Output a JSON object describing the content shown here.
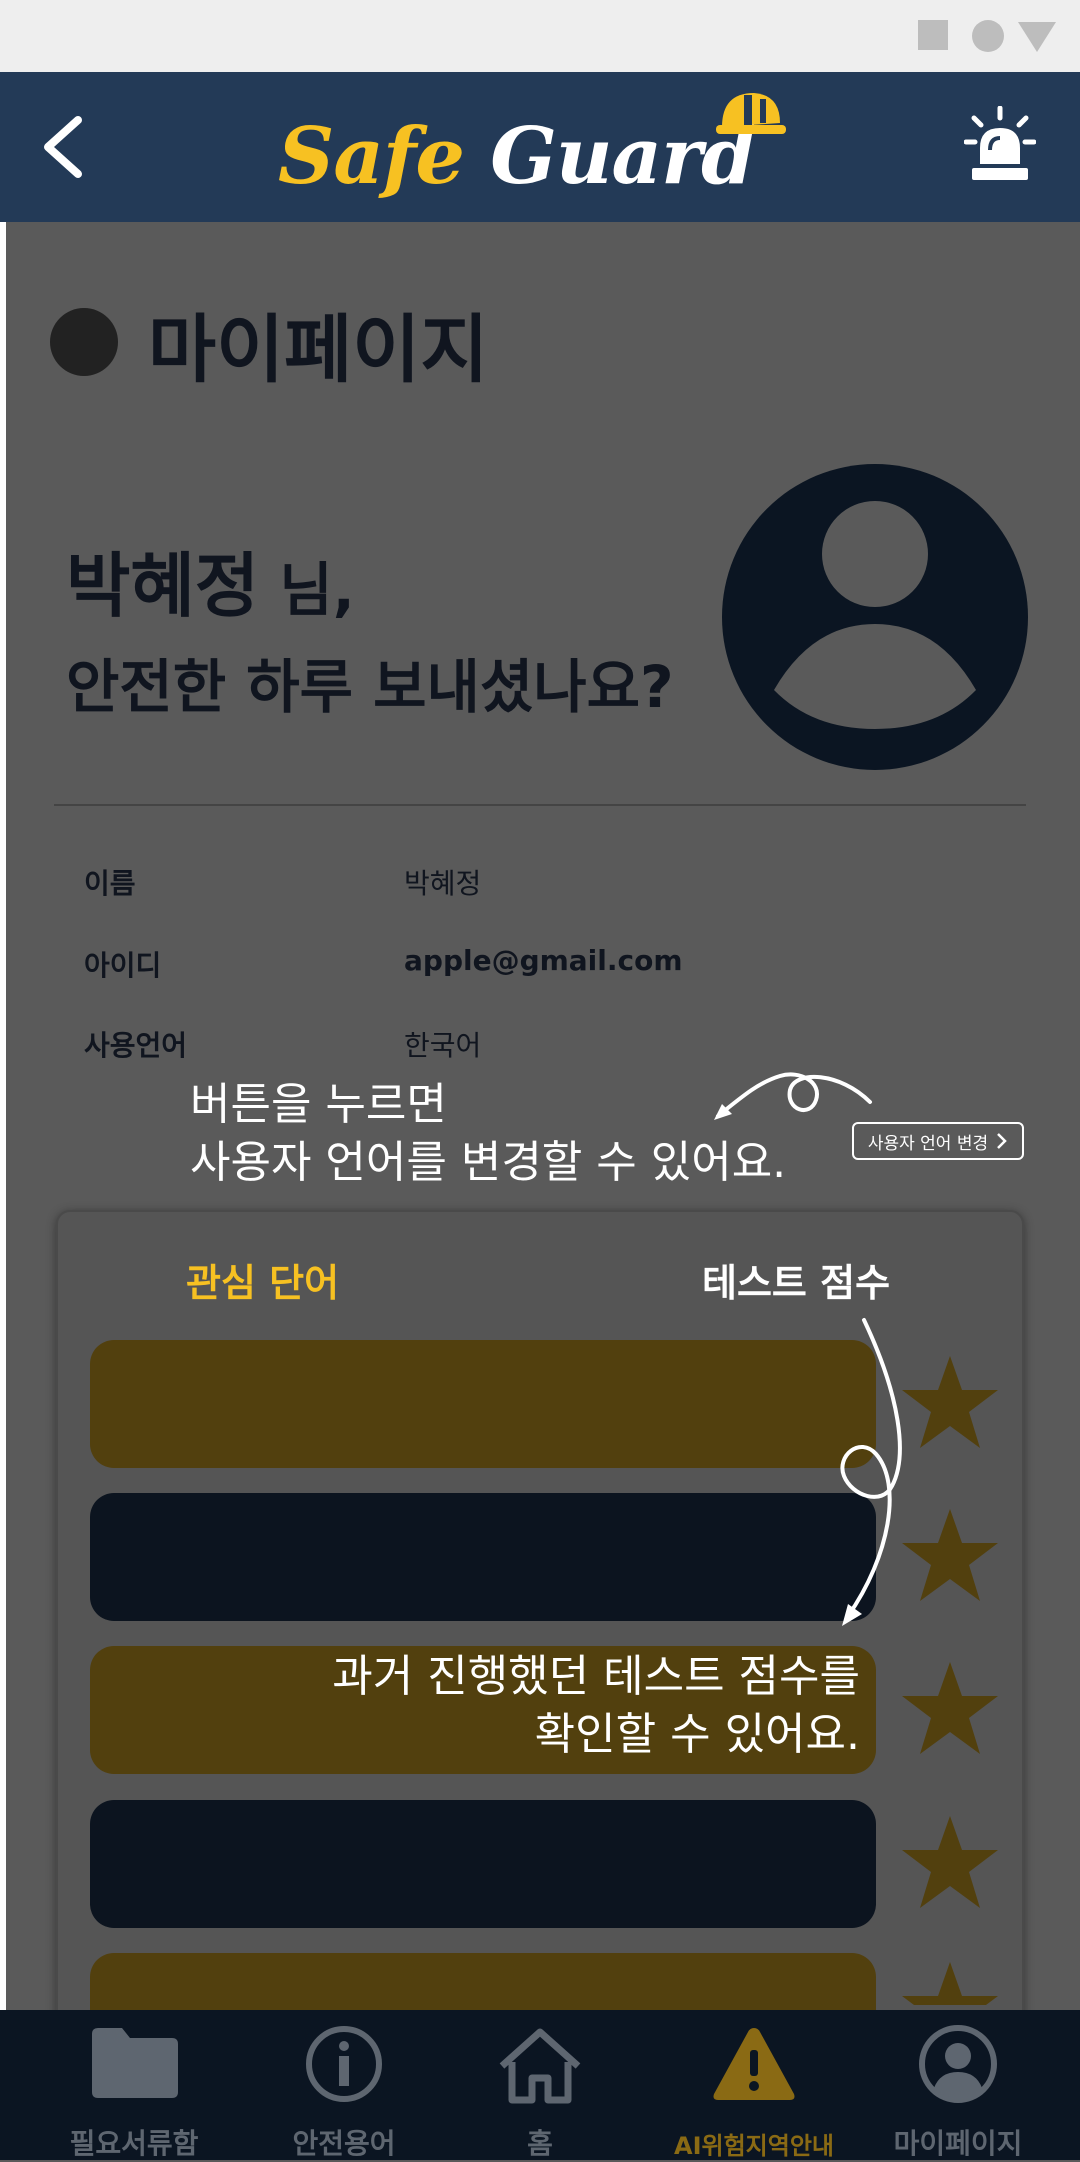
{
  "status_bar": {
    "icons": [
      "square-icon",
      "circle-icon",
      "triangle-icon"
    ]
  },
  "header": {
    "logo_part1": "Safe",
    "logo_part2": "Guard",
    "back_icon": "chevron-left-icon",
    "alarm_icon": "siren-icon"
  },
  "page": {
    "title": "마이페이지"
  },
  "greeting": {
    "name": "박혜정",
    "suffix": " 님,",
    "line2": "안전한 하루 보내셨나요?"
  },
  "profile": {
    "rows": [
      {
        "label": "이름",
        "value": "박혜정"
      },
      {
        "label": "아이디",
        "value": "apple@gmail.com"
      },
      {
        "label": "사용언어",
        "value": "한국어"
      }
    ],
    "change_language_button": "사용자 언어 변경"
  },
  "hints": {
    "language_line1": "버튼을 누르면",
    "language_line2": "사용자 언어를 변경할 수 있어요.",
    "score_line1": "과거 진행했던 테스트 점수를",
    "score_line2": "확인할 수 있어요."
  },
  "tabs": {
    "words": "관심 단어",
    "scores": "테스트 점수"
  },
  "score_rows": [
    {
      "style": "gold",
      "star": "star-icon"
    },
    {
      "style": "dark",
      "star": "star-icon"
    },
    {
      "style": "gold",
      "star": "star-icon"
    },
    {
      "style": "dark",
      "star": "star-icon"
    },
    {
      "style": "gold",
      "star": "star-icon"
    }
  ],
  "bottom_nav": [
    {
      "label": "필요서류함",
      "icon": "folder-icon"
    },
    {
      "label": "안전용어",
      "icon": "info-icon"
    },
    {
      "label": "홈",
      "icon": "home-icon"
    },
    {
      "label": "AI위험지역안내",
      "icon": "warning-icon"
    },
    {
      "label": "마이페이지",
      "icon": "user-icon"
    }
  ],
  "colors": {
    "header": "#233a57",
    "accent": "#f7c122",
    "nav": "#0b1522",
    "overlay": "#5a5a5a"
  }
}
